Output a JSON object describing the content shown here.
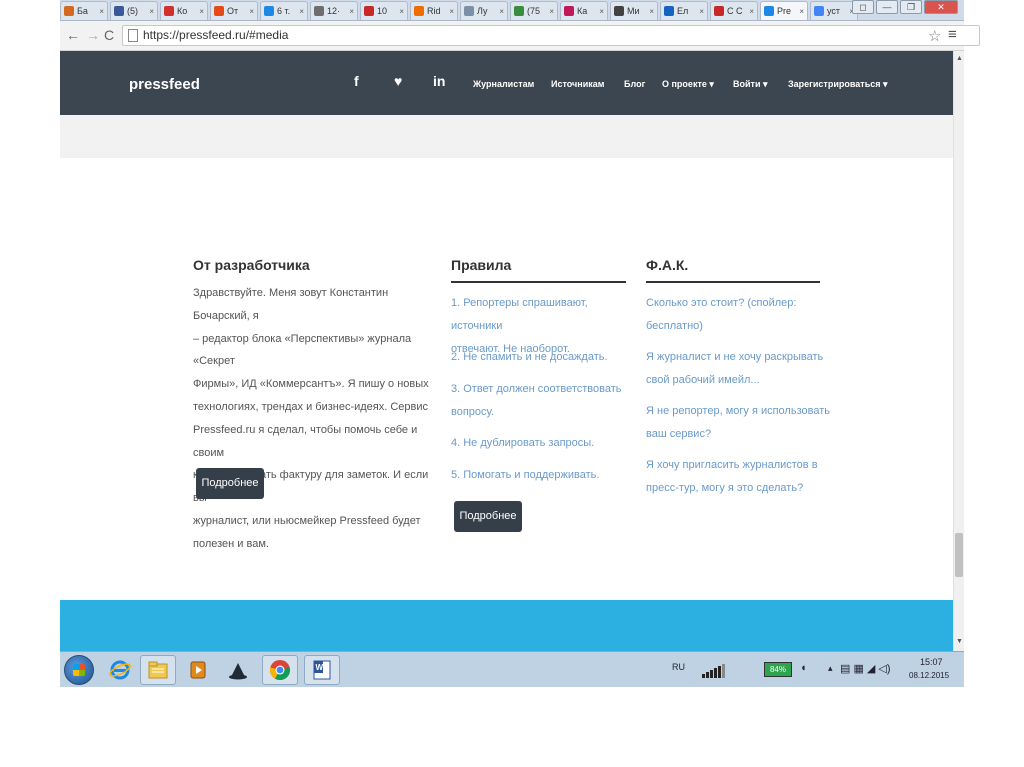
{
  "browser": {
    "tabs": [
      {
        "label": "Ба",
        "color": "#d2691e"
      },
      {
        "label": "(5)",
        "color": "#3b5998"
      },
      {
        "label": "Ко",
        "color": "#d32f2f"
      },
      {
        "label": "От",
        "color": "#e64a19"
      },
      {
        "label": "6 т.",
        "color": "#1e88e5"
      },
      {
        "label": "12·",
        "color": "#6d6d6d"
      },
      {
        "label": "10",
        "color": "#c62828"
      },
      {
        "label": "Rid",
        "color": "#ef6c00"
      },
      {
        "label": "Лу",
        "color": "#7b8fa6"
      },
      {
        "label": "(75",
        "color": "#388e3c"
      },
      {
        "label": "Ка",
        "color": "#c2185b"
      },
      {
        "label": "Ми",
        "color": "#424242"
      },
      {
        "label": "Ел",
        "color": "#1565c0"
      },
      {
        "label": "C C",
        "color": "#c62828"
      },
      {
        "label": "Pre",
        "color": "#1e88e5",
        "active": true
      },
      {
        "label": "уст",
        "color": "#4285f4"
      }
    ],
    "url": "https://pressfeed.ru/#media"
  },
  "site": {
    "logo": "pressfeed",
    "social": [
      "f",
      "♥",
      "in"
    ],
    "nav": [
      "Журналистам",
      "Источникам",
      "Блог",
      "О проекте ▾",
      "Войти ▾",
      "Зарегистрироваться ▾"
    ],
    "columns": {
      "developer": {
        "title": "От разработчика",
        "lines": [
          "Здравствуйте. Меня зовут Константин Бочарский, я",
          "– редактор блока «Перспективы» журнала «Секрет",
          "Фирмы», ИД «Коммерсантъ». Я пишу о новых",
          "технологиях, трендах и бизнес-идеях. Сервис",
          "Pressfeed.ru я сделал, чтобы помочь себе и своим",
          "коллегам искать фактуру для заметок. И если вы",
          "журналист, или ньюсмейкер Pressfeed будет",
          "полезен и вам."
        ],
        "button": "Подробнее"
      },
      "rules": {
        "title": "Правила",
        "items": [
          [
            "1. Репортеры спрашивают, источники",
            "отвечают. Не наоборот."
          ],
          [
            "2. Не спамить и не досаждать."
          ],
          [
            "3. Ответ должен соответствовать",
            "вопросу."
          ],
          [
            "4. Не дублировать запросы."
          ],
          [
            "5. Помогать и поддерживать."
          ]
        ],
        "button": "Подробнее"
      },
      "faq": {
        "title": "Ф.А.К.",
        "items": [
          [
            "Сколько это стоит? (спойлер:",
            "бесплатно)"
          ],
          [
            "Я журналист и не хочу раскрывать",
            "свой рабочий имейл..."
          ],
          [
            "Я не репортер, могу я использовать",
            "ваш сервис?"
          ],
          [
            "Я хочу пригласить журналистов в",
            "пресс-тур, могу я это сделать?"
          ]
        ]
      }
    }
  },
  "taskbar": {
    "lang": "RU",
    "battery": "84%",
    "time": "15:07",
    "date": "08.12.2015"
  },
  "colors": {
    "header": "#3c4651",
    "link": "#6a9ac9",
    "button": "#353f4a",
    "footer_band": "#2cb0e2"
  }
}
